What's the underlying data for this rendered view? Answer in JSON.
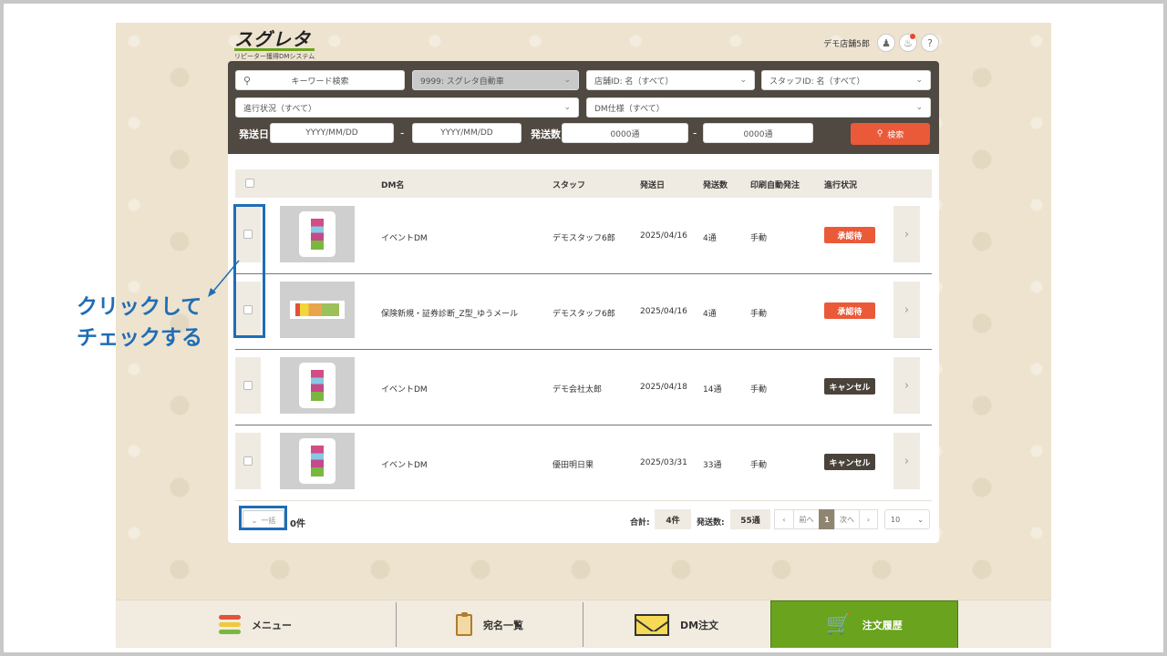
{
  "app": {
    "logo_main": "スグレタ",
    "logo_sub": "リピーター獲得DMシステム",
    "user_name": "デモ店舗5郎"
  },
  "search": {
    "keyword_label": "キーワード検索",
    "campaign_select": "9999: スグレタ自動車",
    "store_select": "店舗ID: 名（すべて）",
    "staff_select": "スタッフID: 名（すべて）",
    "progress_select": "進行状況（すべて）",
    "dm_spec_select": "DM仕様（すべて）",
    "send_date_label": "発送日",
    "date_from_placeholder": "YYYY/MM/DD",
    "date_to_placeholder": "YYYY/MM/DD",
    "send_count_label": "発送数",
    "count_from_placeholder": "0000通",
    "count_to_placeholder": "0000通",
    "search_button": "検索"
  },
  "table": {
    "headers": {
      "dm_name": "DM名",
      "staff": "スタッフ",
      "send_date": "発送日",
      "send_count": "発送数",
      "auto_print": "印刷自動発注",
      "status": "進行状況"
    },
    "rows": [
      {
        "dm_name": "イベントDM",
        "staff": "デモスタッフ6郎",
        "send_date": "2025/04/16",
        "send_count": "4通",
        "auto_print": "手動",
        "status": "承認待"
      },
      {
        "dm_name": "保険新規・証券診断_Z型_ゆうメール",
        "staff": "デモスタッフ6郎",
        "send_date": "2025/04/16",
        "send_count": "4通",
        "auto_print": "手動",
        "status": "承認待"
      },
      {
        "dm_name": "イベントDM",
        "staff": "デモ会社太郎",
        "send_date": "2025/04/18",
        "send_count": "14通",
        "auto_print": "手動",
        "status": "キャンセル"
      },
      {
        "dm_name": "イベントDM",
        "staff": "優田明日果",
        "send_date": "2025/03/31",
        "send_count": "33通",
        "auto_print": "手動",
        "status": "キャンセル"
      }
    ]
  },
  "footer": {
    "bulk_label": "一括",
    "bulk_count": "0件",
    "total_label": "合計:",
    "total_value": "4件",
    "send_total_label": "発送数:",
    "send_total_value": "55通",
    "prev_label": "前へ",
    "page": "1",
    "next_label": "次へ",
    "per_page": "10"
  },
  "nav": {
    "menu": "メニュー",
    "address_list": "宛名一覧",
    "dm_order": "DM注文",
    "order_history": "注文履歴"
  },
  "annotation": {
    "line1": "クリックして",
    "line2": "チェックする"
  },
  "colors": {
    "accent_orange": "#ea5a39",
    "active_green": "#6aa31d",
    "annotation_blue": "#1f6db5",
    "panel_dark": "#4f4941"
  }
}
